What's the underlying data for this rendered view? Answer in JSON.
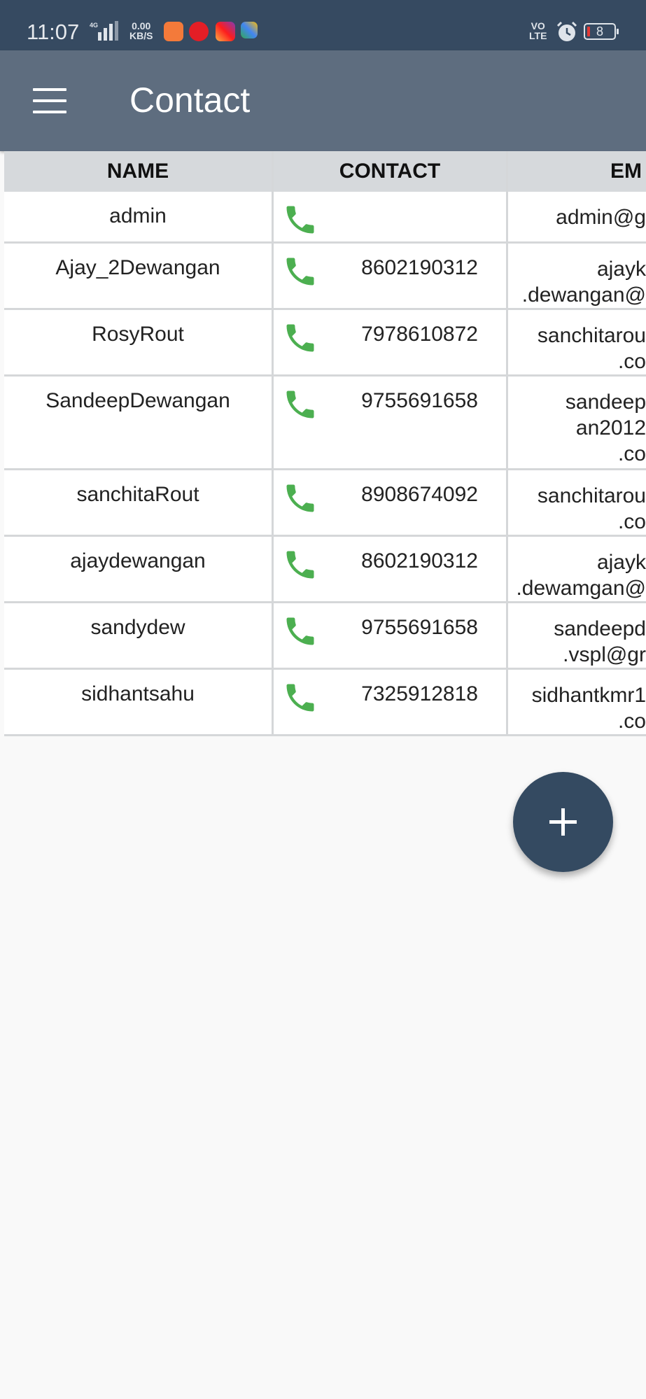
{
  "status_bar": {
    "time": "11:07",
    "network": "4G",
    "speed_top": "0.00",
    "speed_bottom": "KB/S",
    "volte_top": "VO",
    "volte_bottom": "LTE",
    "battery": "8",
    "app_icons": [
      "heart-app-icon",
      "airtel-app-icon",
      "instagram-app-icon",
      "puzzle-app-icon"
    ]
  },
  "app_bar": {
    "title": "Contact"
  },
  "table": {
    "headers": [
      "NAME",
      "CONTACT",
      "EM"
    ],
    "rows": [
      {
        "name": "admin",
        "number": "",
        "email": "admin@g"
      },
      {
        "name": "Ajay_2Dewangan",
        "number": "8602190312",
        "email": "ajayk\n.dewangan@"
      },
      {
        "name": "RosyRout",
        "number": "7978610872",
        "email": "sanchitarou\n.co"
      },
      {
        "name": "SandeepDewangan",
        "number": "9755691658",
        "email": "sandeep\nan2012\n.co"
      },
      {
        "name": "sanchitaRout",
        "number": "8908674092",
        "email": "sanchitarou\n.co"
      },
      {
        "name": "ajaydewangan",
        "number": "8602190312",
        "email": "ajayk\n.dewamgan@"
      },
      {
        "name": "sandydew",
        "number": "9755691658",
        "email": "sandeepd\n.vspl@gr"
      },
      {
        "name": "sidhantsahu",
        "number": "7325912818",
        "email": "sidhantkmr1\n.co"
      }
    ]
  },
  "colors": {
    "status_bar": "#364a61",
    "app_bar": "#5e6d7f",
    "phone_icon": "#4caf50",
    "fab": "#344a61"
  }
}
